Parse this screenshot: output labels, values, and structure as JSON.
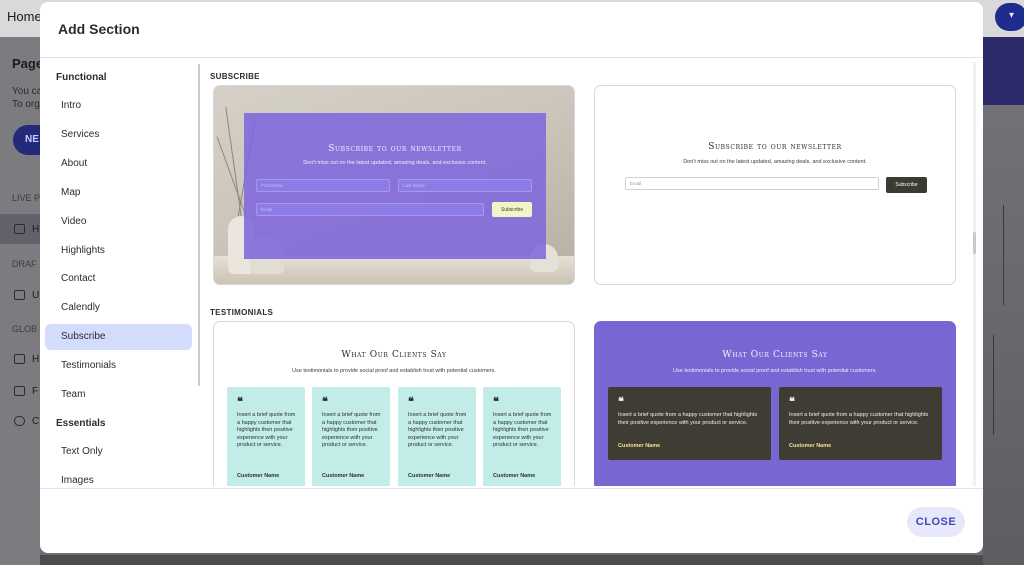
{
  "background": {
    "topbar_home": "Home",
    "page_heading": "Page",
    "page_desc_1": "You ca",
    "page_desc_2": "To org",
    "new_button": "NE",
    "label_live": "LIVE P",
    "live_item": "H",
    "label_draft": "DRAF",
    "draft_item": "U",
    "label_global": "GLOB",
    "global_item_1": "H",
    "global_item_2": "F",
    "global_item_3": "C",
    "filter_icon": "filter-icon"
  },
  "modal": {
    "title": "Add Section",
    "close_label": "CLOSE",
    "sidebar": {
      "groups": [
        {
          "heading": "Functional",
          "items": [
            "Intro",
            "Services",
            "About",
            "Map",
            "Video",
            "Highlights",
            "Contact",
            "Calendly",
            "Subscribe",
            "Testimonials",
            "Team"
          ]
        },
        {
          "heading": "Essentials",
          "items": [
            "Text Only",
            "Images"
          ]
        }
      ],
      "active_item": "Subscribe",
      "active_color": "#d4dcfb"
    },
    "categories": [
      {
        "label": "SUBSCRIBE",
        "cards": [
          {
            "title": "Subscribe to our newsletter",
            "subtitle": "Don't miss out on the latest updated, amazing deals, and exclusive content.",
            "first_name_placeholder": "First Name",
            "last_name_placeholder": "Last Name",
            "email_placeholder": "Email",
            "button": "Subscribe",
            "panel_color": "#8068dc",
            "button_color": "#f1f4c7"
          },
          {
            "title": "Subscribe to our newsletter",
            "subtitle": "Don't miss out on the latest updated, amazing deals, and exclusive content.",
            "email_placeholder": "Email",
            "button": "Subscribe",
            "button_color": "#3b3a33"
          }
        ]
      },
      {
        "label": "TESTIMONIALS",
        "cards": [
          {
            "title": "What Our Clients Say",
            "subtitle": "Use testimonials to provide social proof and establish trust with potential customers.",
            "quote_mark": "❝",
            "quotes": [
              {
                "text": "Insert a brief quote from a happy customer that highlights their positive experience with your product or service.",
                "name": "Customer Name"
              },
              {
                "text": "Insert a brief quote from a happy customer that highlights their positive experience with your product or service.",
                "name": "Customer Name"
              },
              {
                "text": "Insert a brief quote from a happy customer that highlights their positive experience with your product or service.",
                "name": "Customer Name"
              },
              {
                "text": "Insert a brief quote from a happy customer that highlights their positive experience with your product or service.",
                "name": "Customer Name"
              }
            ],
            "quote_bg": "#c1ece8"
          },
          {
            "title": "What Our Clients Say",
            "subtitle": "Use testimonials to provide social proof and establish trust with potential customers.",
            "quote_mark": "❝",
            "quotes": [
              {
                "text": "Insert a brief quote from a happy customer that highlights their positive experience with your product or service.",
                "name": "Customer Name"
              },
              {
                "text": "Insert a brief quote from a happy customer that highlights their positive experience with your product or service.",
                "name": "Customer Name"
              }
            ],
            "card_bg": "#7866d3",
            "quote_bg": "#3f3c33"
          }
        ]
      }
    ]
  }
}
